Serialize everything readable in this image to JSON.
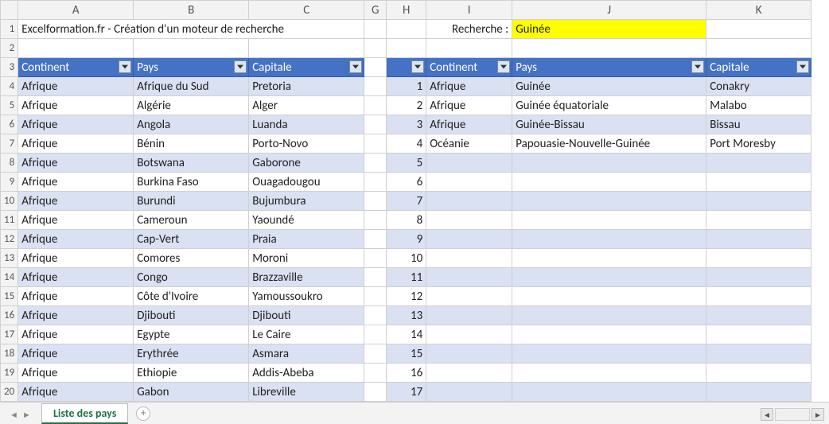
{
  "columns": [
    "A",
    "B",
    "C",
    "G",
    "H",
    "I",
    "J",
    "K"
  ],
  "row_numbers": [
    1,
    2,
    3,
    4,
    5,
    6,
    7,
    8,
    9,
    10,
    11,
    12,
    13,
    14,
    15,
    16,
    17,
    18,
    19,
    20
  ],
  "title": "Excelformation.fr - Création d'un moteur de recherche",
  "search_label": "Recherche :",
  "search_value": "Guinée",
  "headers_left": {
    "continent": "Continent",
    "pays": "Pays",
    "capitale": "Capitale"
  },
  "headers_right": {
    "continent": "Continent",
    "pays": "Pays",
    "capitale": "Capitale"
  },
  "table_left": [
    {
      "continent": "Afrique",
      "pays": "Afrique du Sud",
      "capitale": "Pretoria"
    },
    {
      "continent": "Afrique",
      "pays": "Algérie",
      "capitale": "Alger"
    },
    {
      "continent": "Afrique",
      "pays": "Angola",
      "capitale": "Luanda"
    },
    {
      "continent": "Afrique",
      "pays": "Bénin",
      "capitale": "Porto-Novo"
    },
    {
      "continent": "Afrique",
      "pays": "Botswana",
      "capitale": "Gaborone"
    },
    {
      "continent": "Afrique",
      "pays": "Burkina Faso",
      "capitale": "Ouagadougou"
    },
    {
      "continent": "Afrique",
      "pays": "Burundi",
      "capitale": "Bujumbura"
    },
    {
      "continent": "Afrique",
      "pays": "Cameroun",
      "capitale": "Yaoundé"
    },
    {
      "continent": "Afrique",
      "pays": "Cap-Vert",
      "capitale": "Praia"
    },
    {
      "continent": "Afrique",
      "pays": "Comores",
      "capitale": "Moroni"
    },
    {
      "continent": "Afrique",
      "pays": "Congo",
      "capitale": "Brazzaville"
    },
    {
      "continent": "Afrique",
      "pays": "Côte d'Ivoire",
      "capitale": "Yamoussoukro"
    },
    {
      "continent": "Afrique",
      "pays": "Djibouti",
      "capitale": "Djibouti"
    },
    {
      "continent": "Afrique",
      "pays": "Egypte",
      "capitale": "Le Caire"
    },
    {
      "continent": "Afrique",
      "pays": "Erythrée",
      "capitale": "Asmara"
    },
    {
      "continent": "Afrique",
      "pays": "Ethiopie",
      "capitale": "Addis-Abeba"
    },
    {
      "continent": "Afrique",
      "pays": "Gabon",
      "capitale": "Libreville"
    }
  ],
  "table_right": [
    {
      "n": 1,
      "continent": "Afrique",
      "pays": "Guinée",
      "capitale": "Conakry"
    },
    {
      "n": 2,
      "continent": "Afrique",
      "pays": "Guinée équatoriale",
      "capitale": "Malabo"
    },
    {
      "n": 3,
      "continent": "Afrique",
      "pays": "Guinée-Bissau",
      "capitale": "Bissau"
    },
    {
      "n": 4,
      "continent": "Océanie",
      "pays": "Papouasie-Nouvelle-Guinée",
      "capitale": "Port Moresby"
    },
    {
      "n": 5,
      "continent": "",
      "pays": "",
      "capitale": ""
    },
    {
      "n": 6,
      "continent": "",
      "pays": "",
      "capitale": ""
    },
    {
      "n": 7,
      "continent": "",
      "pays": "",
      "capitale": ""
    },
    {
      "n": 8,
      "continent": "",
      "pays": "",
      "capitale": ""
    },
    {
      "n": 9,
      "continent": "",
      "pays": "",
      "capitale": ""
    },
    {
      "n": 10,
      "continent": "",
      "pays": "",
      "capitale": ""
    },
    {
      "n": 11,
      "continent": "",
      "pays": "",
      "capitale": ""
    },
    {
      "n": 12,
      "continent": "",
      "pays": "",
      "capitale": ""
    },
    {
      "n": 13,
      "continent": "",
      "pays": "",
      "capitale": ""
    },
    {
      "n": 14,
      "continent": "",
      "pays": "",
      "capitale": ""
    },
    {
      "n": 15,
      "continent": "",
      "pays": "",
      "capitale": ""
    },
    {
      "n": 16,
      "continent": "",
      "pays": "",
      "capitale": ""
    },
    {
      "n": 17,
      "continent": "",
      "pays": "",
      "capitale": ""
    }
  ],
  "sheet_tab": "Liste des pays"
}
